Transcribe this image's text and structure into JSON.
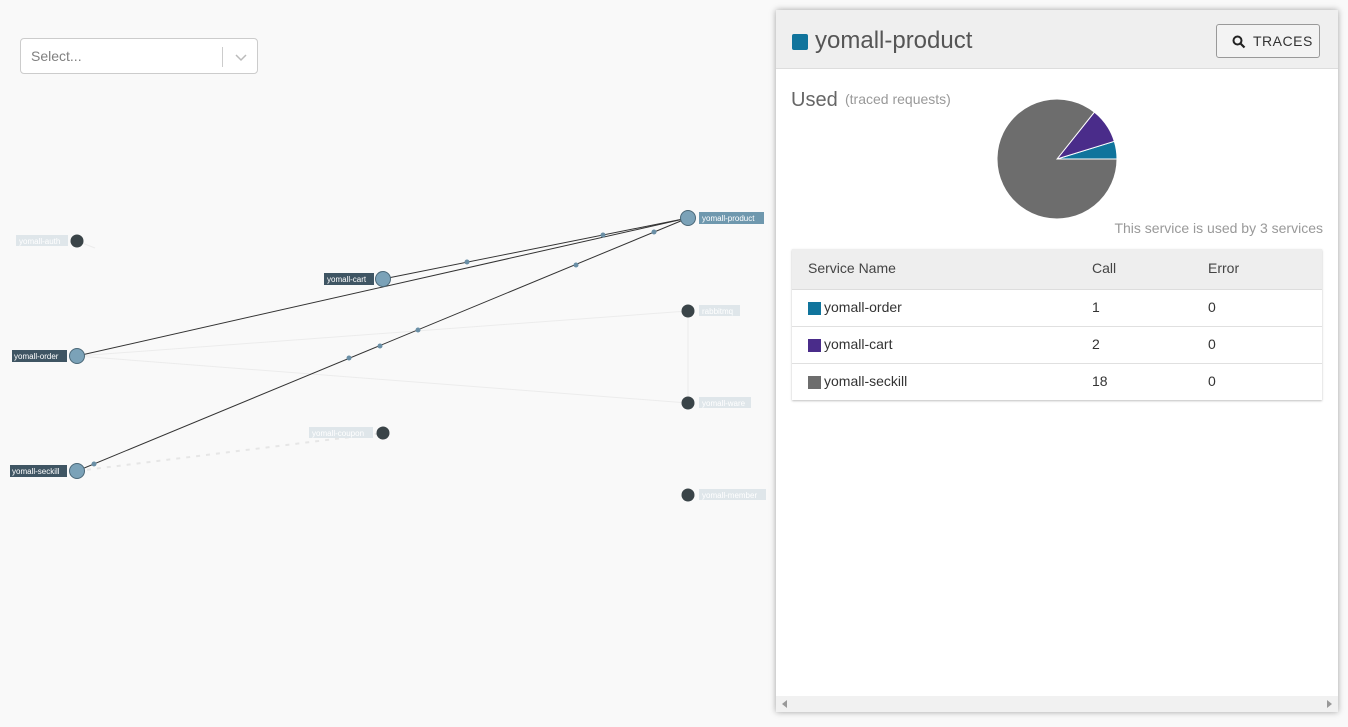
{
  "search": {
    "placeholder": "Select..."
  },
  "graph": {
    "nodes": [
      {
        "id": "auth",
        "label": "yomall-auth",
        "active": false
      },
      {
        "id": "cart",
        "label": "yomall-cart",
        "active": true
      },
      {
        "id": "order",
        "label": "yomall-order",
        "active": true
      },
      {
        "id": "seckill",
        "label": "yomall-seckill",
        "active": true
      },
      {
        "id": "coupon",
        "label": "yomall-coupon",
        "active": false
      },
      {
        "id": "product",
        "label": "yomall-product",
        "active": true
      },
      {
        "id": "rabbitmq",
        "label": "rabbitmq",
        "active": false
      },
      {
        "id": "ware",
        "label": "yomall-ware",
        "active": false
      },
      {
        "id": "member",
        "label": "yomall-member",
        "active": false
      }
    ]
  },
  "panel": {
    "title": "yomall-product",
    "service_color": "#10749c",
    "traces_label": "TRACES",
    "used_label": "Used",
    "used_sub": "(traced requests)",
    "used_by_text": "This service is used by 3 services",
    "table": {
      "headers": [
        "Service Name",
        "Call",
        "Error"
      ],
      "rows": [
        {
          "name": "yomall-order",
          "call": "1",
          "error": "0",
          "color": "#10749c"
        },
        {
          "name": "yomall-cart",
          "call": "2",
          "error": "0",
          "color": "#4a2c8a"
        },
        {
          "name": "yomall-seckill",
          "call": "18",
          "error": "0",
          "color": "#6d6d6d"
        }
      ]
    }
  },
  "chart_data": {
    "type": "pie",
    "categories": [
      "yomall-order",
      "yomall-cart",
      "yomall-seckill"
    ],
    "values": [
      1,
      2,
      18
    ],
    "colors": [
      "#10749c",
      "#4a2c8a",
      "#6d6d6d"
    ]
  }
}
